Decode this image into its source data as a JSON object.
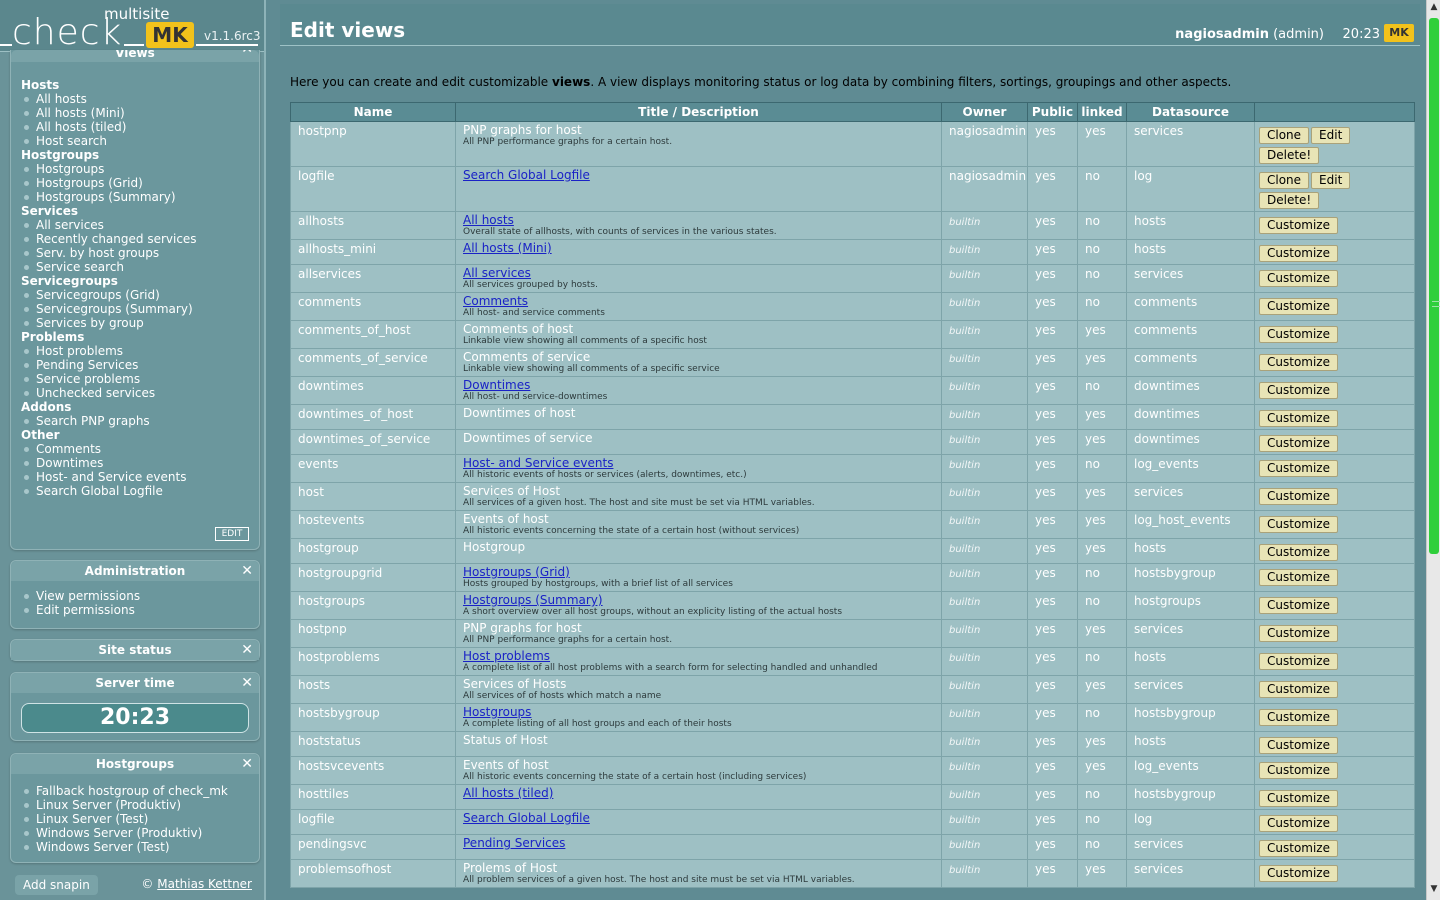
{
  "logo": {
    "multisite": "multisite",
    "check": "check",
    "mk": "MK",
    "version": "v1.1.6rc3"
  },
  "sidebar": {
    "views_title": "Views",
    "views": [
      {
        "title": "Hosts",
        "items": [
          "All hosts",
          "All hosts (Mini)",
          "All hosts (tiled)",
          "Host search"
        ]
      },
      {
        "title": "Hostgroups",
        "items": [
          "Hostgroups",
          "Hostgroups (Grid)",
          "Hostgroups (Summary)"
        ]
      },
      {
        "title": "Services",
        "items": [
          "All services",
          "Recently changed services",
          "Serv. by host groups",
          "Service search"
        ]
      },
      {
        "title": "Servicegroups",
        "items": [
          "Servicegroups (Grid)",
          "Servicegroups (Summary)",
          "Services by group"
        ]
      },
      {
        "title": "Problems",
        "items": [
          "Host problems",
          "Pending Services",
          "Service problems",
          "Unchecked services"
        ]
      },
      {
        "title": "Addons",
        "items": [
          "Search PNP graphs"
        ]
      },
      {
        "title": "Other",
        "items": [
          "Comments",
          "Downtimes",
          "Host- and Service events",
          "Search Global Logfile"
        ]
      }
    ],
    "edit_label": "EDIT",
    "admin": {
      "title": "Administration",
      "items": [
        "View permissions",
        "Edit permissions"
      ]
    },
    "site_status": {
      "title": "Site status"
    },
    "server_time": {
      "title": "Server time",
      "time": "20:23"
    },
    "hostgroups": {
      "title": "Hostgroups",
      "items": [
        "Fallback hostgroup of check_mk",
        "Linux Server (Produktiv)",
        "Linux Server (Test)",
        "Windows Server (Produktiv)",
        "Windows Server (Test)"
      ]
    },
    "close_glyph": "✕",
    "add_snapin": "Add snapin",
    "copyright": "©",
    "copyright_link": "Mathias Kettner"
  },
  "header": {
    "title": "Edit views",
    "user": "nagiosadmin",
    "role": "(admin)",
    "time": "20:23",
    "mk": "MK"
  },
  "intro": {
    "before": "Here you can create and edit customizable",
    "bold": "views",
    "after": ". A view displays monitoring status or log data by combining filters, sortings, groupings and other aspects."
  },
  "table": {
    "headers": [
      "Name",
      "Title / Description",
      "Owner",
      "Public",
      "linked",
      "Datasource",
      ""
    ],
    "buttons": {
      "clone": "Clone",
      "edit": "Edit",
      "delete": "Delete!",
      "customize": "Customize"
    },
    "rows": [
      {
        "name": "hostpnp",
        "title": "PNP graphs for host",
        "link": false,
        "desc": "All PNP performance graphs for a certain host.",
        "owner": "nagiosadmin",
        "builtin": false,
        "public": "yes",
        "linked": "yes",
        "ds": "services"
      },
      {
        "name": "logfile",
        "title": "Search Global Logfile",
        "link": true,
        "desc": "",
        "owner": "nagiosadmin",
        "builtin": false,
        "public": "yes",
        "linked": "no",
        "ds": "log"
      },
      {
        "name": "allhosts",
        "title": "All hosts",
        "link": true,
        "desc": "Overall state of allhosts, with counts of services in the various states.",
        "owner": "builtin",
        "builtin": true,
        "public": "yes",
        "linked": "no",
        "ds": "hosts"
      },
      {
        "name": "allhosts_mini",
        "title": "All hosts (Mini)",
        "link": true,
        "desc": "",
        "owner": "builtin",
        "builtin": true,
        "public": "yes",
        "linked": "no",
        "ds": "hosts"
      },
      {
        "name": "allservices",
        "title": "All services",
        "link": true,
        "desc": "All services grouped by hosts.",
        "owner": "builtin",
        "builtin": true,
        "public": "yes",
        "linked": "no",
        "ds": "services"
      },
      {
        "name": "comments",
        "title": "Comments",
        "link": true,
        "desc": "All host- and service comments",
        "owner": "builtin",
        "builtin": true,
        "public": "yes",
        "linked": "no",
        "ds": "comments"
      },
      {
        "name": "comments_of_host",
        "title": "Comments of host",
        "link": false,
        "desc": "Linkable view showing all comments of a specific host",
        "owner": "builtin",
        "builtin": true,
        "public": "yes",
        "linked": "yes",
        "ds": "comments"
      },
      {
        "name": "comments_of_service",
        "title": "Comments of service",
        "link": false,
        "desc": "Linkable view showing all comments of a specific service",
        "owner": "builtin",
        "builtin": true,
        "public": "yes",
        "linked": "yes",
        "ds": "comments"
      },
      {
        "name": "downtimes",
        "title": "Downtimes",
        "link": true,
        "desc": "All host- und service-downtimes",
        "owner": "builtin",
        "builtin": true,
        "public": "yes",
        "linked": "no",
        "ds": "downtimes"
      },
      {
        "name": "downtimes_of_host",
        "title": "Downtimes of host",
        "link": false,
        "desc": "",
        "owner": "builtin",
        "builtin": true,
        "public": "yes",
        "linked": "yes",
        "ds": "downtimes"
      },
      {
        "name": "downtimes_of_service",
        "title": "Downtimes of service",
        "link": false,
        "desc": "",
        "owner": "builtin",
        "builtin": true,
        "public": "yes",
        "linked": "yes",
        "ds": "downtimes"
      },
      {
        "name": "events",
        "title": "Host- and Service events",
        "link": true,
        "desc": "All historic events of hosts or services (alerts, downtimes, etc.)",
        "owner": "builtin",
        "builtin": true,
        "public": "yes",
        "linked": "no",
        "ds": "log_events"
      },
      {
        "name": "host",
        "title": "Services of Host",
        "link": false,
        "desc": "All services of a given host. The host and site must be set via HTML variables.",
        "owner": "builtin",
        "builtin": true,
        "public": "yes",
        "linked": "yes",
        "ds": "services"
      },
      {
        "name": "hostevents",
        "title": "Events of host",
        "link": false,
        "desc": "All historic events concerning the state of a certain host (without services)",
        "owner": "builtin",
        "builtin": true,
        "public": "yes",
        "linked": "yes",
        "ds": "log_host_events"
      },
      {
        "name": "hostgroup",
        "title": "Hostgroup",
        "link": false,
        "desc": "",
        "owner": "builtin",
        "builtin": true,
        "public": "yes",
        "linked": "yes",
        "ds": "hosts"
      },
      {
        "name": "hostgroupgrid",
        "title": "Hostgroups (Grid)",
        "link": true,
        "desc": "Hosts grouped by hostgroups, with a brief list of all services",
        "owner": "builtin",
        "builtin": true,
        "public": "yes",
        "linked": "no",
        "ds": "hostsbygroup"
      },
      {
        "name": "hostgroups",
        "title": "Hostgroups (Summary)",
        "link": true,
        "desc": "A short overview over all host groups, without an explicity listing of the actual hosts",
        "owner": "builtin",
        "builtin": true,
        "public": "yes",
        "linked": "no",
        "ds": "hostgroups"
      },
      {
        "name": "hostpnp",
        "title": "PNP graphs for host",
        "link": false,
        "desc": "All PNP performance graphs for a certain host.",
        "owner": "builtin",
        "builtin": true,
        "public": "yes",
        "linked": "yes",
        "ds": "services"
      },
      {
        "name": "hostproblems",
        "title": "Host problems",
        "link": true,
        "desc": "A complete list of all host problems with a search form for selecting handled and unhandled",
        "owner": "builtin",
        "builtin": true,
        "public": "yes",
        "linked": "no",
        "ds": "hosts"
      },
      {
        "name": "hosts",
        "title": "Services of Hosts",
        "link": false,
        "desc": "All services of of hosts which match a name",
        "owner": "builtin",
        "builtin": true,
        "public": "yes",
        "linked": "yes",
        "ds": "services"
      },
      {
        "name": "hostsbygroup",
        "title": "Hostgroups",
        "link": true,
        "desc": "A complete listing of all host groups and each of their hosts",
        "owner": "builtin",
        "builtin": true,
        "public": "yes",
        "linked": "no",
        "ds": "hostsbygroup"
      },
      {
        "name": "hoststatus",
        "title": "Status of Host",
        "link": false,
        "desc": "",
        "owner": "builtin",
        "builtin": true,
        "public": "yes",
        "linked": "yes",
        "ds": "hosts"
      },
      {
        "name": "hostsvcevents",
        "title": "Events of host",
        "link": false,
        "desc": "All historic events concerning the state of a certain host (including services)",
        "owner": "builtin",
        "builtin": true,
        "public": "yes",
        "linked": "yes",
        "ds": "log_events"
      },
      {
        "name": "hosttiles",
        "title": "All hosts (tiled)",
        "link": true,
        "desc": "",
        "owner": "builtin",
        "builtin": true,
        "public": "yes",
        "linked": "no",
        "ds": "hostsbygroup"
      },
      {
        "name": "logfile",
        "title": "Search Global Logfile",
        "link": true,
        "desc": "",
        "owner": "builtin",
        "builtin": true,
        "public": "yes",
        "linked": "no",
        "ds": "log"
      },
      {
        "name": "pendingsvc",
        "title": "Pending Services",
        "link": true,
        "desc": "",
        "owner": "builtin",
        "builtin": true,
        "public": "yes",
        "linked": "no",
        "ds": "services"
      },
      {
        "name": "problemsofhost",
        "title": "Prolems of Host",
        "link": false,
        "desc": "All problem services of a given host. The host and site must be set via HTML variables.",
        "owner": "builtin",
        "builtin": true,
        "public": "yes",
        "linked": "yes",
        "ds": "services"
      }
    ]
  },
  "scrollbar": {
    "up": "▲",
    "down": "▼"
  }
}
